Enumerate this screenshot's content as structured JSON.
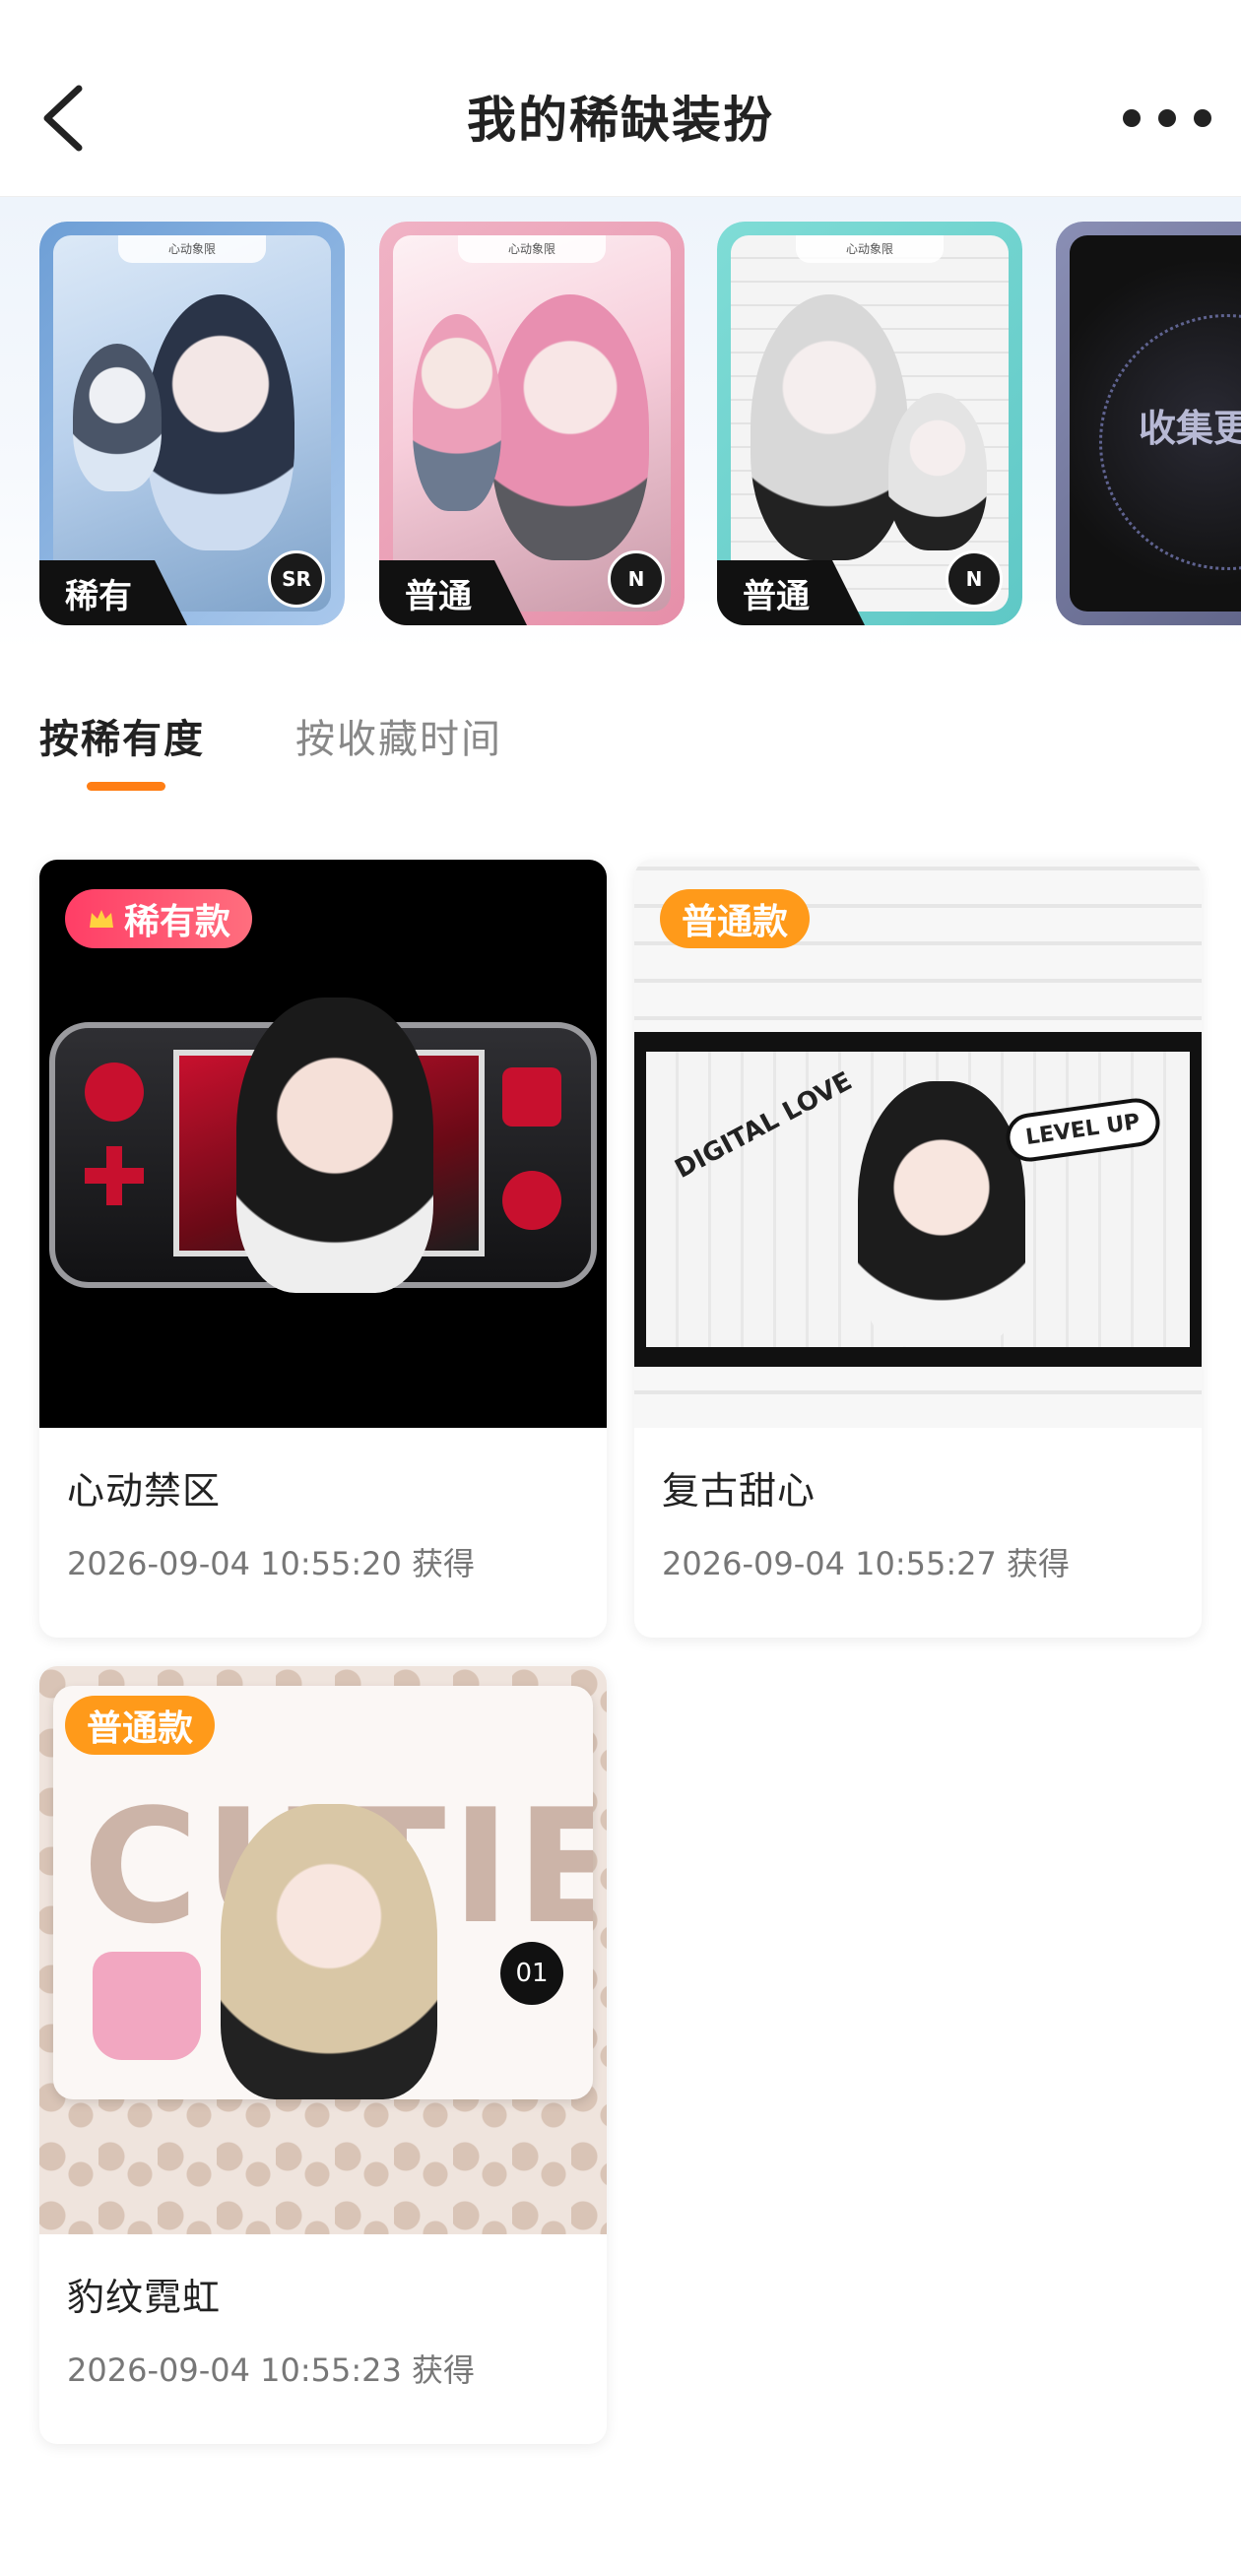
{
  "header": {
    "title": "我的稀缺装扮",
    "back_icon": "chevron-left-icon",
    "more_icon": "more-horizontal-icon"
  },
  "carousel": {
    "cards": [
      {
        "rarity_label": "稀有",
        "rank": "SR",
        "frame_color": "#6e9fd6",
        "top_text": "心动象限"
      },
      {
        "rarity_label": "普通",
        "rank": "N",
        "frame_color": "#e68fa9",
        "top_text": "心动象限"
      },
      {
        "rarity_label": "普通",
        "rank": "N",
        "frame_color": "#5fc8c6",
        "top_text": "心动象限"
      }
    ],
    "more_card": {
      "label": "收集更"
    }
  },
  "tabs": {
    "items": [
      {
        "label": "按稀有度",
        "active": true
      },
      {
        "label": "按收藏时间",
        "active": false
      }
    ],
    "accent_color": "#ff7e14"
  },
  "collection": {
    "items": [
      {
        "badge": "稀有款",
        "badge_type": "rare",
        "name": "心动禁区",
        "time": "2026-09-04 10:55:20 获得"
      },
      {
        "badge": "普通款",
        "badge_type": "normal",
        "name": "复古甜心",
        "time": "2026-09-04 10:55:27 获得",
        "art_text_1": "DIGITAL LOVE",
        "art_text_2": "LEVEL UP"
      },
      {
        "badge": "普通款",
        "badge_type": "normal",
        "name": "豹纹霓虹",
        "time": "2026-09-04 10:55:23 获得",
        "art_text_1": "CUTIE",
        "art_text_2": "01"
      }
    ]
  }
}
